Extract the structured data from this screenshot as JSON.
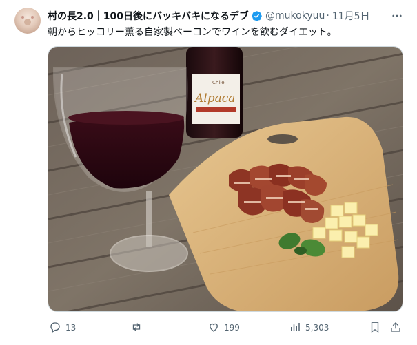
{
  "tweet": {
    "author": {
      "display_name": "村の長2.0｜100日後にバッキバキになるデブ",
      "handle": "@mukokyuu‍",
      "verified": true
    },
    "separator": "·",
    "timestamp": "11月5日",
    "text": "朝からヒッコリー薫る自家製ベーコンでワインを飲むダイエット。",
    "media": {
      "label_text": "Chile",
      "label_brand": "Alpaca"
    },
    "actions": {
      "replies": "13",
      "reposts": "",
      "likes": "199",
      "views": "5,303"
    }
  },
  "icons": {
    "more": "more-icon",
    "verified": "verified-badge-icon",
    "reply": "reply-icon",
    "repost": "repost-icon",
    "like": "heart-icon",
    "views": "views-chart-icon",
    "bookmark": "bookmark-icon",
    "share": "share-icon"
  },
  "colors": {
    "text_primary": "#0f1419",
    "text_secondary": "#536471",
    "verified": "#1d9bf0"
  }
}
